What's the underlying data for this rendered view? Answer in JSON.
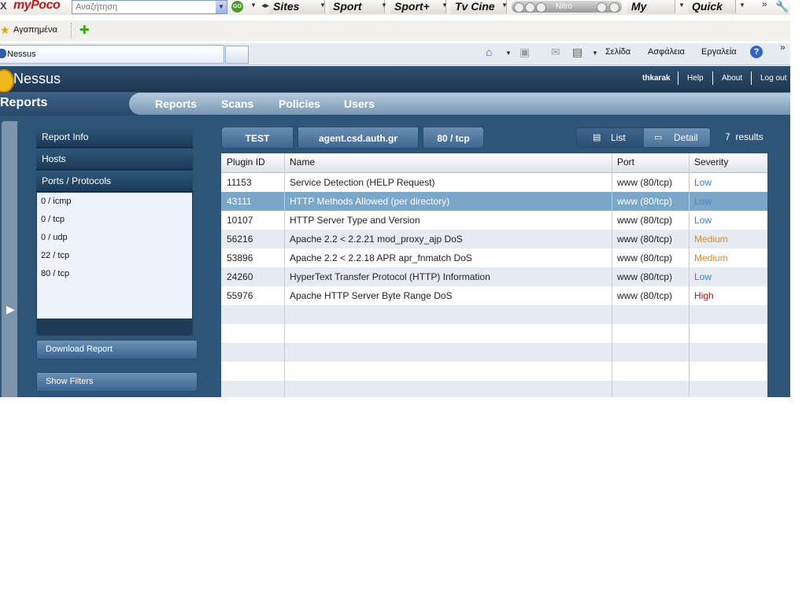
{
  "browser": {
    "toolbar": {
      "close_glyph": "X",
      "brand": "myPoco",
      "search_placeholder": "Αναζήτηση",
      "go_label": "GO",
      "buttons": [
        "Sites",
        "Sport",
        "Sport+",
        "Tv Cine",
        "My",
        "Quick"
      ],
      "nitro_label": "Nitro",
      "overflow": "»"
    },
    "favorites": {
      "label": "Αγαπημένα"
    },
    "tab": {
      "title": "Nessus"
    },
    "commands": {
      "page": "Σελίδα",
      "security": "Ασφάλεια",
      "tools": "Εργαλεία",
      "help": "?"
    }
  },
  "app": {
    "brand": "Nessus",
    "user": {
      "name": "thkarak",
      "help": "Help",
      "about": "About",
      "logout": "Log out"
    },
    "section_title": "Reports",
    "nav": [
      "Reports",
      "Scans",
      "Policies",
      "Users"
    ],
    "sidebar": {
      "tabs": [
        "Report Info",
        "Hosts",
        "Ports / Protocols"
      ],
      "items": [
        "0 / icmp",
        "0 / tcp",
        "0 / udp",
        "22 / tcp",
        "80 / tcp"
      ],
      "download_button": "Download Report",
      "filters_button": "Show Filters"
    },
    "breadcrumb": [
      "TEST",
      "agent.csd.auth.gr",
      "80 / tcp"
    ],
    "view_toggle": {
      "list": "List",
      "detail": "Detail"
    },
    "results": {
      "count": "7",
      "label": "results"
    },
    "table": {
      "columns": [
        "Plugin ID",
        "Name",
        "Port",
        "Severity"
      ],
      "rows": [
        {
          "id": "11153",
          "name": "Service Detection (HELP Request)",
          "port": "www (80/tcp)",
          "severity": "Low"
        },
        {
          "id": "43111",
          "name": "HTTP Methods Allowed (per directory)",
          "port": "www (80/tcp)",
          "severity": "Low"
        },
        {
          "id": "10107",
          "name": "HTTP Server Type and Version",
          "port": "www (80/tcp)",
          "severity": "Low"
        },
        {
          "id": "56216",
          "name": "Apache 2.2 < 2.2.21 mod_proxy_ajp DoS",
          "port": "www (80/tcp)",
          "severity": "Medium"
        },
        {
          "id": "53896",
          "name": "Apache 2.2 < 2.2.18 APR apr_fnmatch DoS",
          "port": "www (80/tcp)",
          "severity": "Medium"
        },
        {
          "id": "24260",
          "name": "HyperText Transfer Protocol (HTTP) Information",
          "port": "www (80/tcp)",
          "severity": "Low"
        },
        {
          "id": "55976",
          "name": "Apache HTTP Server Byte Range DoS",
          "port": "www (80/tcp)",
          "severity": "High"
        }
      ],
      "selected_row": 1
    },
    "severity_colors": {
      "Low": "#3e7fc1",
      "Medium": "#d98a1f",
      "High": "#b3141b"
    }
  }
}
